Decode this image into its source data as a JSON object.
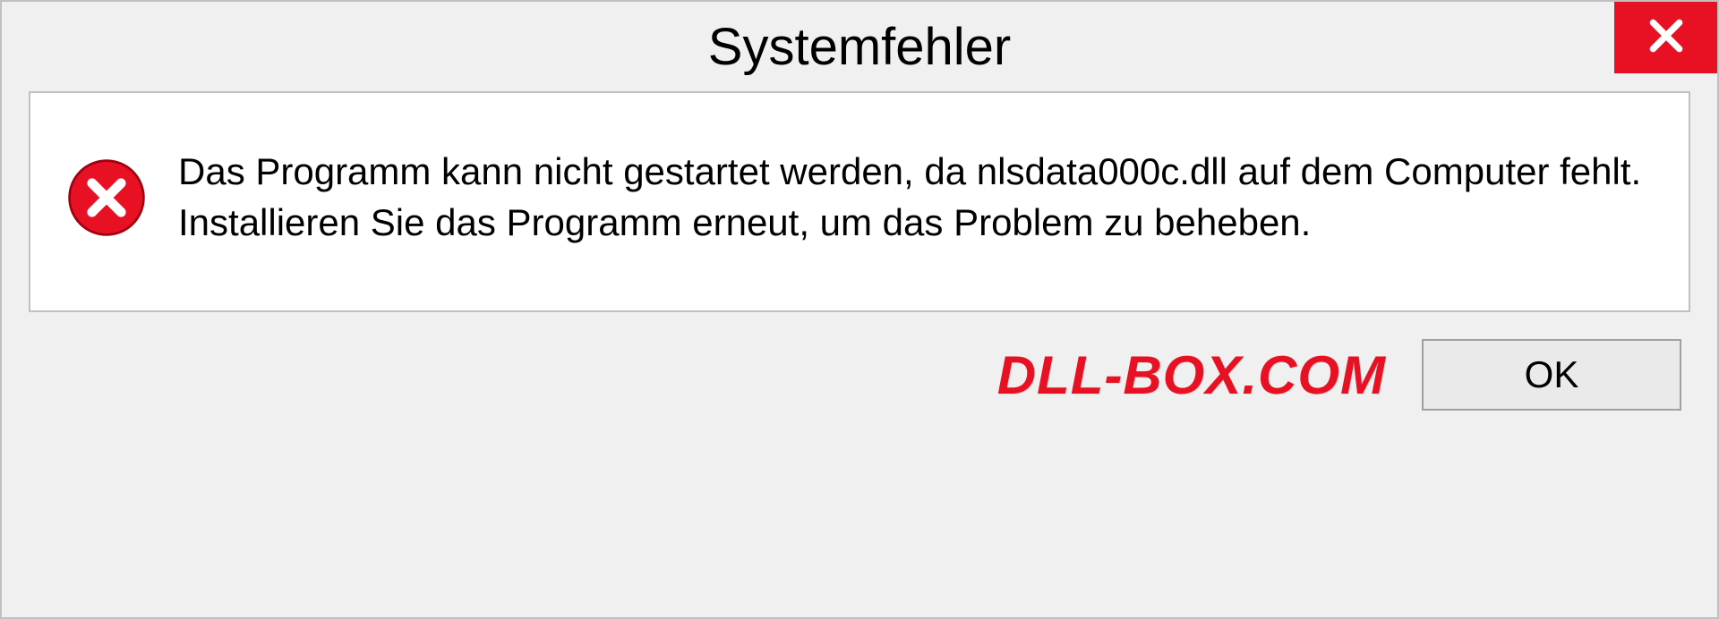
{
  "dialog": {
    "title": "Systemfehler",
    "message": "Das Programm kann nicht gestartet werden, da nlsdata000c.dll auf dem Computer fehlt. Installieren Sie das Programm erneut, um das Problem zu beheben.",
    "ok_label": "OK"
  },
  "watermark": "DLL-BOX.COM"
}
